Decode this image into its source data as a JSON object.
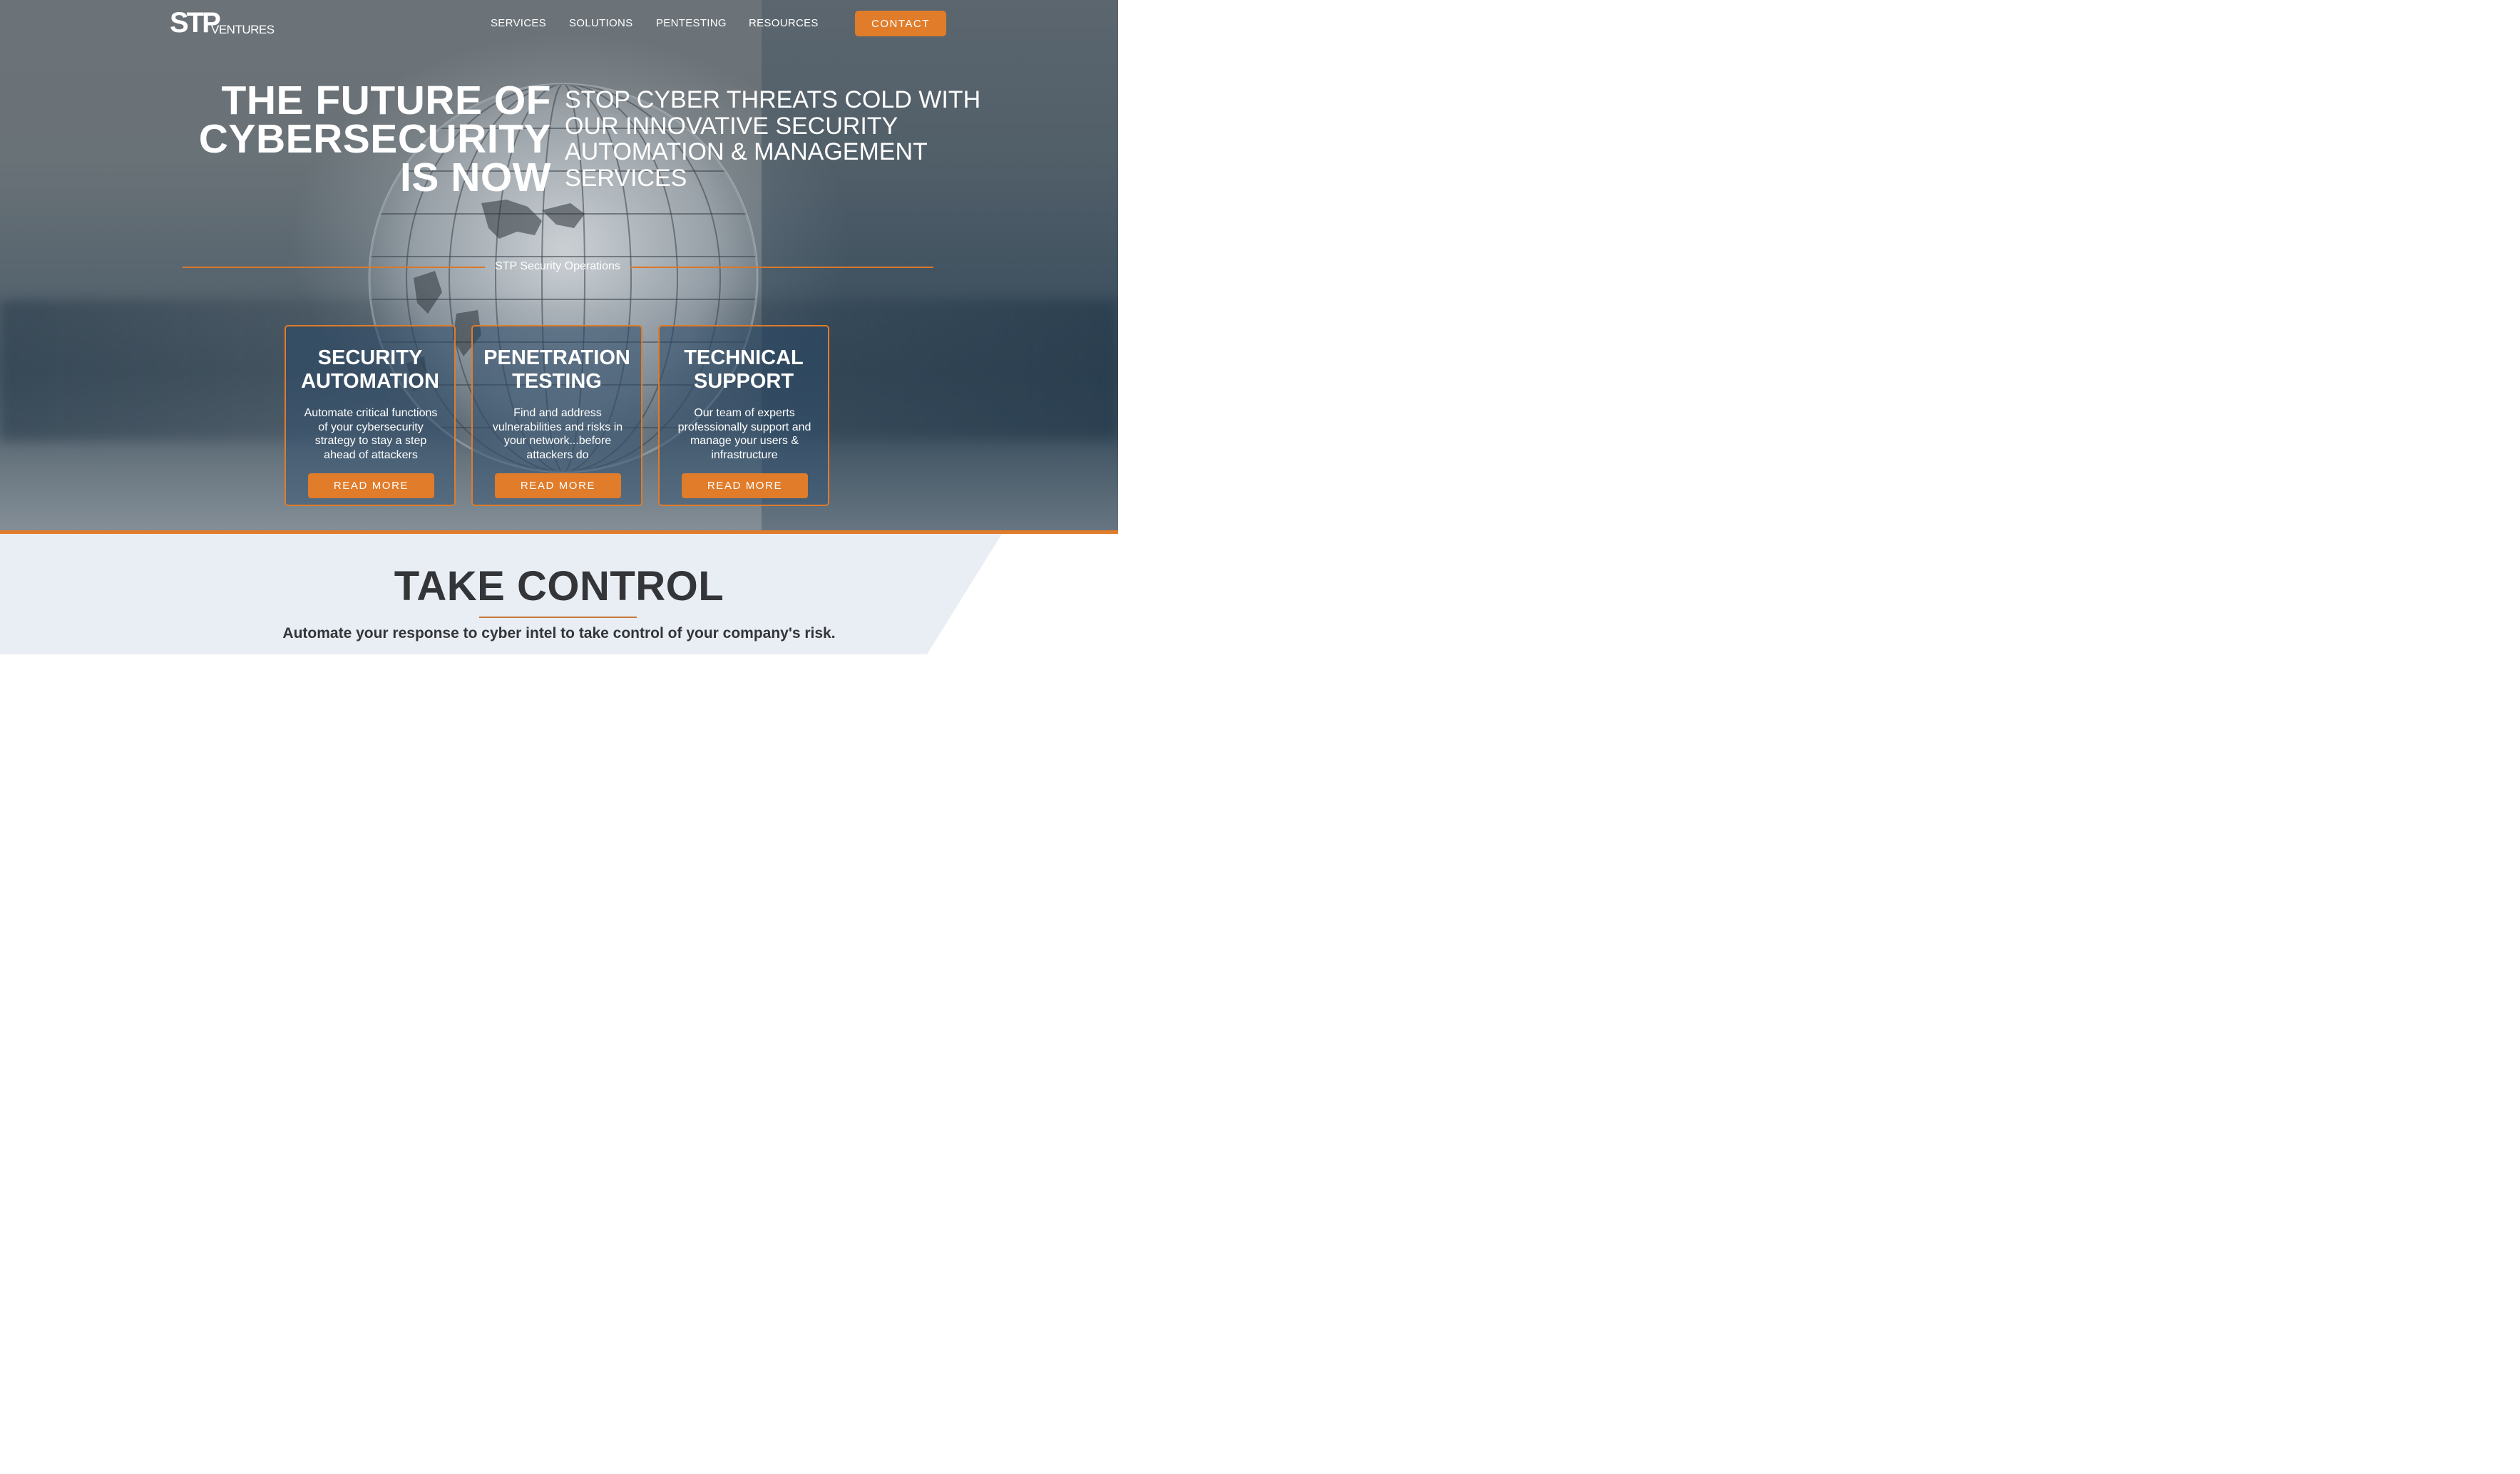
{
  "brand": {
    "logo_text_primary": "STP",
    "logo_text_secondary": "VENTURES"
  },
  "nav": {
    "items": [
      {
        "label": "SERVICES"
      },
      {
        "label": "SOLUTIONS"
      },
      {
        "label": "PENTESTING"
      },
      {
        "label": "RESOURCES"
      }
    ],
    "contact_label": "CONTACT"
  },
  "hero": {
    "headline_lines": [
      "THE FUTURE OF",
      "CYBERSECURITY",
      "IS NOW"
    ],
    "subline_lines": [
      "STOP CYBER THREATS COLD WITH",
      "OUR INNOVATIVE SECURITY",
      "AUTOMATION & MANAGEMENT",
      "SERVICES"
    ],
    "section_label": "STP Security Operations"
  },
  "cards": [
    {
      "title_lines": [
        "SECURITY",
        "AUTOMATION"
      ],
      "desc_lines": [
        "Automate critical functions",
        "of your cybersecurity",
        "strategy to stay a step",
        "ahead of attackers"
      ],
      "button_label": "READ MORE"
    },
    {
      "title_lines": [
        "PENETRATION",
        "TESTING"
      ],
      "desc_lines": [
        "Find and address",
        "vulnerabilities and risks in",
        "your network...before",
        "attackers do"
      ],
      "button_label": "READ MORE"
    },
    {
      "title_lines": [
        "TECHNICAL",
        "SUPPORT"
      ],
      "desc_lines": [
        "Our team of experts",
        "professionally support and",
        "manage your users &",
        "infrastructure"
      ],
      "button_label": "READ MORE"
    }
  ],
  "take_control": {
    "title": "TAKE CONTROL",
    "subtitle": "Automate your response to cyber intel to take control of your company's risk."
  },
  "colors": {
    "accent": "#e07c2a",
    "text_dark": "#333538",
    "lower_bg": "#e9edf4"
  },
  "icons": [
    "globe-graphic",
    "logo-mark"
  ]
}
